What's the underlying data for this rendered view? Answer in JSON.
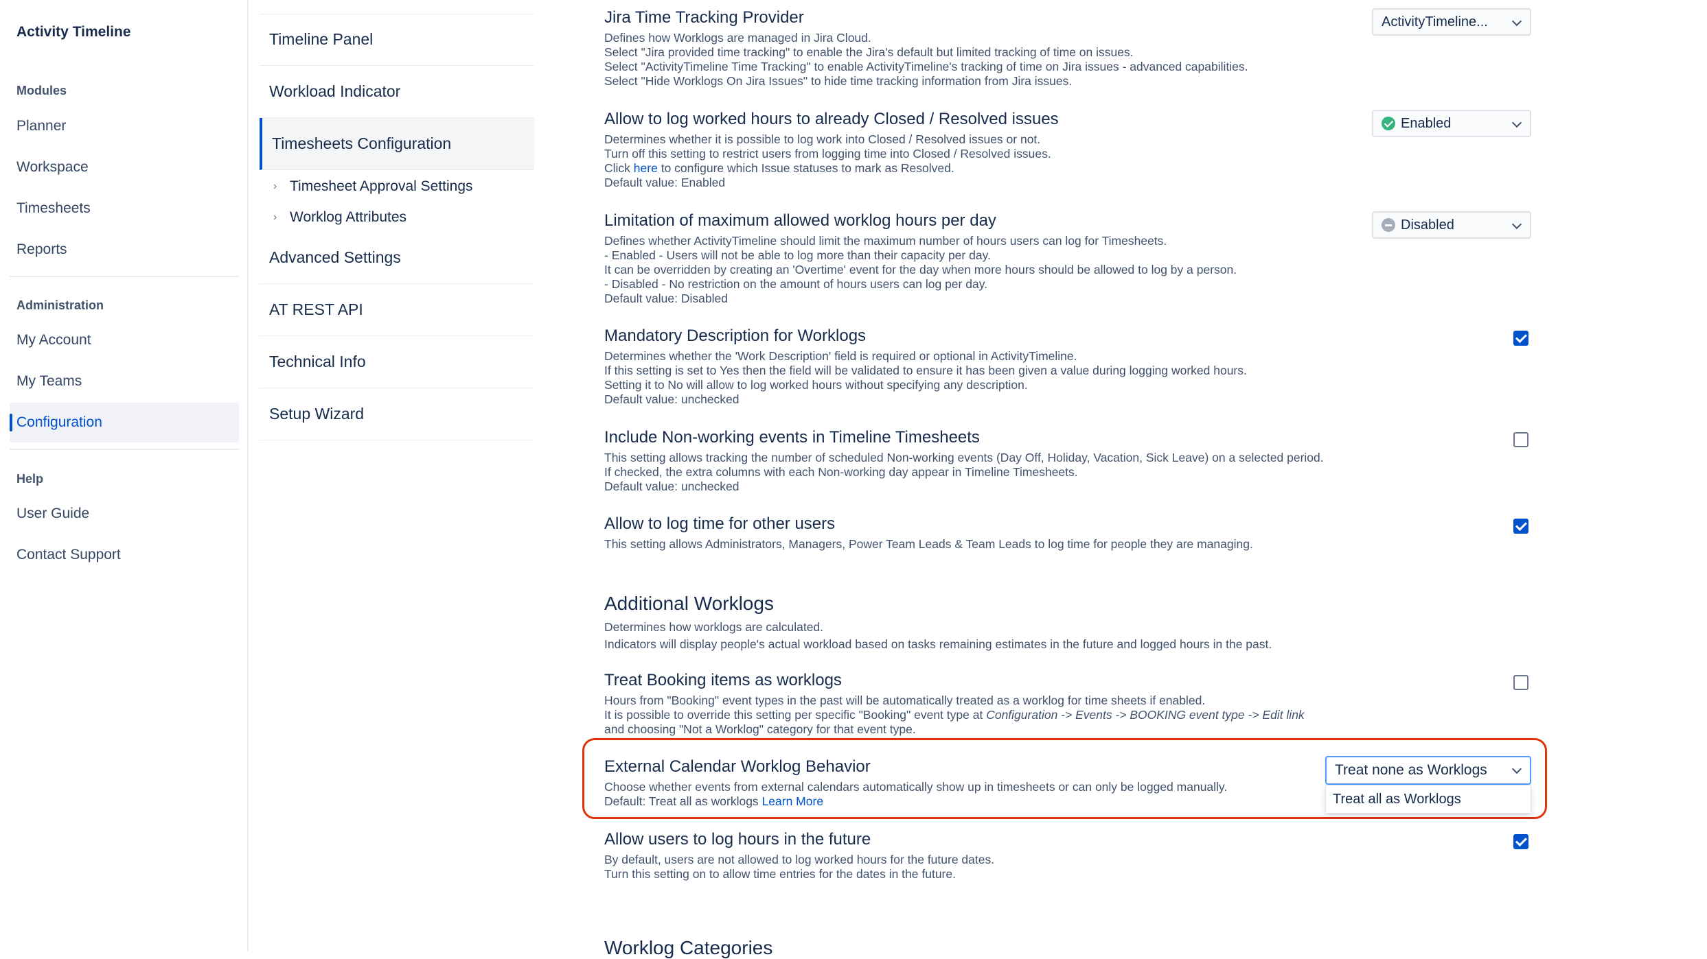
{
  "app": {
    "title": "Activity Timeline"
  },
  "sidebar": {
    "modules_heading": "Modules",
    "modules": [
      "Planner",
      "Workspace",
      "Timesheets",
      "Reports"
    ],
    "admin_heading": "Administration",
    "admin": [
      "My Account",
      "My Teams",
      "Configuration"
    ],
    "help_heading": "Help",
    "help": [
      "User Guide",
      "Contact Support"
    ]
  },
  "config_nav": {
    "items": [
      "Timeline Panel",
      "Workload Indicator",
      "Timesheets Configuration",
      "Advanced Settings",
      "AT REST API",
      "Technical Info",
      "Setup Wizard"
    ],
    "sub_items": [
      "Timesheet Approval Settings",
      "Worklog Attributes"
    ],
    "active": "Timesheets Configuration"
  },
  "settings": {
    "tracking": {
      "title": "Jira Time Tracking Provider",
      "lines": [
        "Defines how Worklogs are managed in Jira Cloud.",
        "Select \"Jira provided time tracking\" to enable the Jira's default but limited tracking of time on issues.",
        "Select \"ActivityTimeline Time Tracking\" to enable ActivityTimeline's tracking of time on Jira issues - advanced capabilities.",
        "Select \"Hide Worklogs On Jira Issues\" to hide time tracking information from Jira issues."
      ],
      "value": "ActivityTimeline..."
    },
    "closed": {
      "title": "Allow to log worked hours to already Closed / Resolved issues",
      "lines": [
        "Determines whether it is possible to log work into Closed / Resolved issues or not.",
        "Turn off this setting to restrict users from logging time into Closed / Resolved issues."
      ],
      "click_prefix": "Click",
      "link": "here",
      "click_suffix": "to configure which Issue statuses to mark as Resolved.",
      "default": "Default value: Enabled",
      "value": "Enabled"
    },
    "limit": {
      "title": "Limitation of maximum allowed worklog hours per day",
      "lines": [
        "Defines whether ActivityTimeline should limit the maximum number of hours users can log for Timesheets.",
        "- Enabled - Users will not be able to log more than their capacity per day.",
        "It can be overridden by creating an 'Overtime' event for the day when more hours should be allowed to log by a person.",
        "- Disabled - No restriction on the amount of hours users can log per day.",
        "Default value: Disabled"
      ],
      "value": "Disabled"
    },
    "mandatory": {
      "title": "Mandatory Description for Worklogs",
      "lines": [
        "Determines whether the 'Work Description' field is required or optional in ActivityTimeline.",
        "If this setting is set to Yes then the field will be validated to ensure it has been given a value during logging worked hours.",
        "Setting it to No will allow to log worked hours without specifying any description.",
        "Default value: unchecked"
      ],
      "checked": true
    },
    "nonworking": {
      "title": "Include Non-working events in Timeline Timesheets",
      "lines": [
        "This setting allows tracking the number of scheduled Non-working events (Day Off, Holiday, Vacation, Sick Leave) on a selected period.",
        "If checked, the extra columns with each Non-working day appear in Timeline Timesheets.",
        "Default value: unchecked"
      ],
      "checked": false
    },
    "others": {
      "title": "Allow to log time for other users",
      "lines": [
        "This setting allows Administrators, Managers, Power Team Leads & Team Leads to log time for people they are managing."
      ],
      "checked": true
    },
    "additional": {
      "title": "Additional Worklogs",
      "lines": [
        "Determines how worklogs are calculated.",
        "Indicators will display people's actual workload based on tasks remaining estimates in the future and logged hours in the past."
      ]
    },
    "booking": {
      "title": "Treat Booking items as worklogs",
      "line1": "Hours from \"Booking\" event types in the past will be automatically treated as a worklog for time sheets if enabled.",
      "line2_prefix": "It is possible to override this setting per specific \"Booking\" event type at",
      "line2_italic": "Configuration -> Events -> BOOKING event type -> Edit link",
      "line3": "and choosing \"Not a Worklog\" category for that event type.",
      "checked": false
    },
    "external": {
      "title": "External Calendar Worklog Behavior",
      "line1": "Choose whether events from external calendars automatically show up in timesheets or can only be logged manually.",
      "default_prefix": "Default: Treat all as worklogs",
      "learn_more": "Learn More",
      "value": "Treat none as Worklogs",
      "options": [
        "Treat all as Worklogs"
      ]
    },
    "future": {
      "title": "Allow users to log hours in the future",
      "lines": [
        "By default, users are not allowed to log worked hours for the future dates.",
        "Turn this setting on to allow time entries for the dates in the future."
      ],
      "checked": true
    },
    "categories": {
      "title": "Worklog Categories"
    }
  },
  "colors": {
    "accent": "#0052cc",
    "highlight": "#de350b",
    "success": "#36b37e"
  }
}
